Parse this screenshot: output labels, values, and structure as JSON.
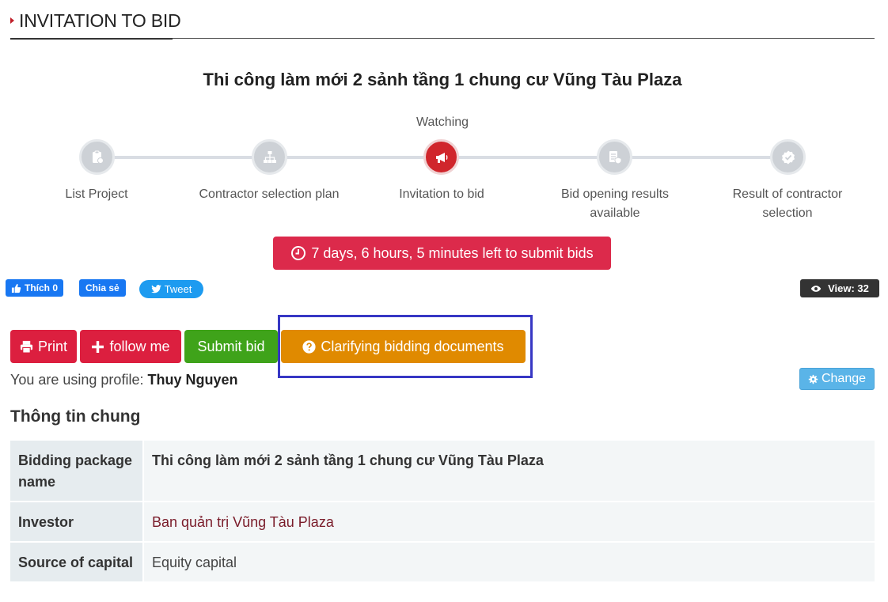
{
  "header": {
    "title": "INVITATION TO BID"
  },
  "package_title": "Thi công làm mới 2 sảnh tầng 1 chung cư Vũng Tàu Plaza",
  "progress": {
    "current_label": "Watching",
    "steps": [
      {
        "label": "List Project",
        "icon": "clipboard-icon",
        "active": false
      },
      {
        "label": "Contractor selection plan",
        "icon": "sitemap-icon",
        "active": false
      },
      {
        "label": "Invitation to bid",
        "icon": "megaphone-icon",
        "active": true
      },
      {
        "label": "Bid opening results available",
        "icon": "document-shield-icon",
        "active": false
      },
      {
        "label": "Result of contractor selection",
        "icon": "badge-check-icon",
        "active": false
      }
    ]
  },
  "countdown": {
    "text": "7 days, 6 hours, 5 minutes left to submit bids"
  },
  "social": {
    "like_label": "Thích 0",
    "share_label": "Chia sẻ",
    "tweet_label": "Tweet"
  },
  "views": {
    "label": "View: 32"
  },
  "actions": {
    "print": "Print",
    "follow": "follow me",
    "submit": "Submit bid",
    "clarify": "Clarifying bidding documents"
  },
  "profile": {
    "prefix": "You are using profile:",
    "name": "Thuy Nguyen",
    "change_label": "Change"
  },
  "general_info": {
    "title": "Thông tin chung",
    "rows": [
      {
        "key": "Bidding package name",
        "value": "Thi công làm mới 2 sảnh tầng 1 chung cư Vũng Tàu Plaza"
      },
      {
        "key": "Investor",
        "value": "Ban quản trị Vũng Tàu Plaza"
      },
      {
        "key": "Source of capital",
        "value": "Equity capital"
      }
    ]
  },
  "colors": {
    "accent_red": "#dc1f3f",
    "countdown_red": "#dc2a4b",
    "submit_green": "#3fa31a",
    "clarify_orange": "#e08a00",
    "highlight_box": "#3737c4"
  }
}
